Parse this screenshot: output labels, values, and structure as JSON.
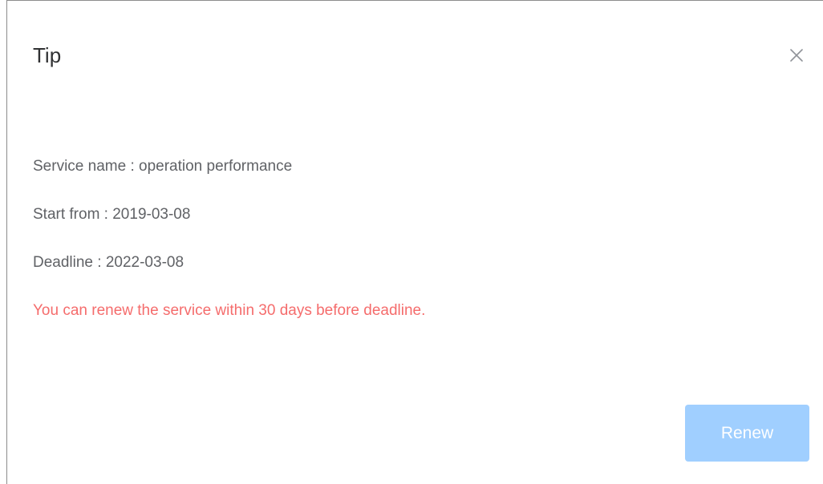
{
  "dialog": {
    "title": "Tip",
    "close_icon": "close-icon",
    "service_name": "Service name : operation performance",
    "start_from": "Start from : 2019-03-08",
    "deadline": "Deadline : 2022-03-08",
    "notice": "You can renew the service within 30 days before deadline.",
    "renew_label": "Renew"
  },
  "colors": {
    "title_text": "#303133",
    "body_text": "#606266",
    "notice_text": "#f56c6c",
    "renew_button_bg": "#a0cfff",
    "renew_button_text": "#ffffff",
    "close_icon": "#909399"
  }
}
